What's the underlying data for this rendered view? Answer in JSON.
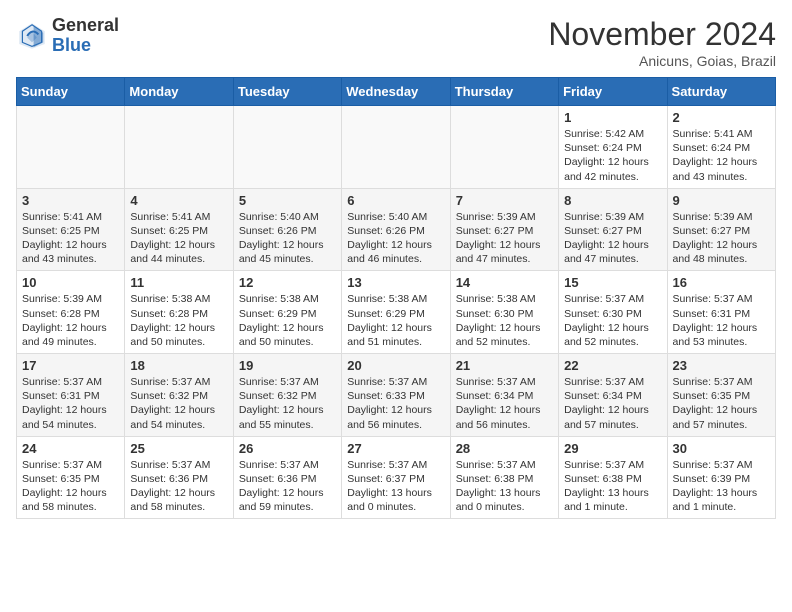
{
  "header": {
    "logo_general": "General",
    "logo_blue": "Blue",
    "month_title": "November 2024",
    "location": "Anicuns, Goias, Brazil"
  },
  "weekdays": [
    "Sunday",
    "Monday",
    "Tuesday",
    "Wednesday",
    "Thursday",
    "Friday",
    "Saturday"
  ],
  "weeks": [
    [
      {
        "day": "",
        "info": ""
      },
      {
        "day": "",
        "info": ""
      },
      {
        "day": "",
        "info": ""
      },
      {
        "day": "",
        "info": ""
      },
      {
        "day": "",
        "info": ""
      },
      {
        "day": "1",
        "info": "Sunrise: 5:42 AM\nSunset: 6:24 PM\nDaylight: 12 hours\nand 42 minutes."
      },
      {
        "day": "2",
        "info": "Sunrise: 5:41 AM\nSunset: 6:24 PM\nDaylight: 12 hours\nand 43 minutes."
      }
    ],
    [
      {
        "day": "3",
        "info": "Sunrise: 5:41 AM\nSunset: 6:25 PM\nDaylight: 12 hours\nand 43 minutes."
      },
      {
        "day": "4",
        "info": "Sunrise: 5:41 AM\nSunset: 6:25 PM\nDaylight: 12 hours\nand 44 minutes."
      },
      {
        "day": "5",
        "info": "Sunrise: 5:40 AM\nSunset: 6:26 PM\nDaylight: 12 hours\nand 45 minutes."
      },
      {
        "day": "6",
        "info": "Sunrise: 5:40 AM\nSunset: 6:26 PM\nDaylight: 12 hours\nand 46 minutes."
      },
      {
        "day": "7",
        "info": "Sunrise: 5:39 AM\nSunset: 6:27 PM\nDaylight: 12 hours\nand 47 minutes."
      },
      {
        "day": "8",
        "info": "Sunrise: 5:39 AM\nSunset: 6:27 PM\nDaylight: 12 hours\nand 47 minutes."
      },
      {
        "day": "9",
        "info": "Sunrise: 5:39 AM\nSunset: 6:27 PM\nDaylight: 12 hours\nand 48 minutes."
      }
    ],
    [
      {
        "day": "10",
        "info": "Sunrise: 5:39 AM\nSunset: 6:28 PM\nDaylight: 12 hours\nand 49 minutes."
      },
      {
        "day": "11",
        "info": "Sunrise: 5:38 AM\nSunset: 6:28 PM\nDaylight: 12 hours\nand 50 minutes."
      },
      {
        "day": "12",
        "info": "Sunrise: 5:38 AM\nSunset: 6:29 PM\nDaylight: 12 hours\nand 50 minutes."
      },
      {
        "day": "13",
        "info": "Sunrise: 5:38 AM\nSunset: 6:29 PM\nDaylight: 12 hours\nand 51 minutes."
      },
      {
        "day": "14",
        "info": "Sunrise: 5:38 AM\nSunset: 6:30 PM\nDaylight: 12 hours\nand 52 minutes."
      },
      {
        "day": "15",
        "info": "Sunrise: 5:37 AM\nSunset: 6:30 PM\nDaylight: 12 hours\nand 52 minutes."
      },
      {
        "day": "16",
        "info": "Sunrise: 5:37 AM\nSunset: 6:31 PM\nDaylight: 12 hours\nand 53 minutes."
      }
    ],
    [
      {
        "day": "17",
        "info": "Sunrise: 5:37 AM\nSunset: 6:31 PM\nDaylight: 12 hours\nand 54 minutes."
      },
      {
        "day": "18",
        "info": "Sunrise: 5:37 AM\nSunset: 6:32 PM\nDaylight: 12 hours\nand 54 minutes."
      },
      {
        "day": "19",
        "info": "Sunrise: 5:37 AM\nSunset: 6:32 PM\nDaylight: 12 hours\nand 55 minutes."
      },
      {
        "day": "20",
        "info": "Sunrise: 5:37 AM\nSunset: 6:33 PM\nDaylight: 12 hours\nand 56 minutes."
      },
      {
        "day": "21",
        "info": "Sunrise: 5:37 AM\nSunset: 6:34 PM\nDaylight: 12 hours\nand 56 minutes."
      },
      {
        "day": "22",
        "info": "Sunrise: 5:37 AM\nSunset: 6:34 PM\nDaylight: 12 hours\nand 57 minutes."
      },
      {
        "day": "23",
        "info": "Sunrise: 5:37 AM\nSunset: 6:35 PM\nDaylight: 12 hours\nand 57 minutes."
      }
    ],
    [
      {
        "day": "24",
        "info": "Sunrise: 5:37 AM\nSunset: 6:35 PM\nDaylight: 12 hours\nand 58 minutes."
      },
      {
        "day": "25",
        "info": "Sunrise: 5:37 AM\nSunset: 6:36 PM\nDaylight: 12 hours\nand 58 minutes."
      },
      {
        "day": "26",
        "info": "Sunrise: 5:37 AM\nSunset: 6:36 PM\nDaylight: 12 hours\nand 59 minutes."
      },
      {
        "day": "27",
        "info": "Sunrise: 5:37 AM\nSunset: 6:37 PM\nDaylight: 13 hours\nand 0 minutes."
      },
      {
        "day": "28",
        "info": "Sunrise: 5:37 AM\nSunset: 6:38 PM\nDaylight: 13 hours\nand 0 minutes."
      },
      {
        "day": "29",
        "info": "Sunrise: 5:37 AM\nSunset: 6:38 PM\nDaylight: 13 hours\nand 1 minute."
      },
      {
        "day": "30",
        "info": "Sunrise: 5:37 AM\nSunset: 6:39 PM\nDaylight: 13 hours\nand 1 minute."
      }
    ]
  ]
}
